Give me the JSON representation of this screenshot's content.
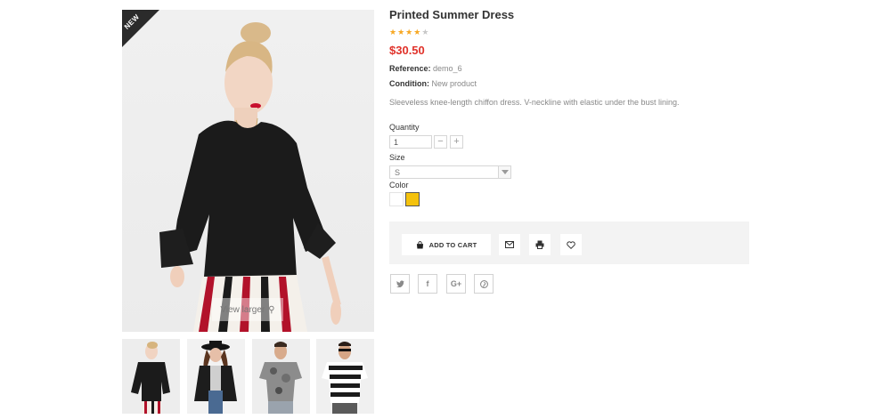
{
  "gallery": {
    "badge": "NEW",
    "view_larger": "View larger",
    "thumbnails": [
      {
        "icon": "thumb-black-top-woman"
      },
      {
        "icon": "thumb-hat-cardigan-woman"
      },
      {
        "icon": "thumb-printed-tee-man"
      },
      {
        "icon": "thumb-striped-tee-man"
      }
    ]
  },
  "product": {
    "name": "Printed Summer Dress",
    "rating": 4,
    "rating_max": 5,
    "price": "$30.50",
    "reference_label": "Reference:",
    "reference_value": "demo_6",
    "condition_label": "Condition:",
    "condition_value": "New product",
    "description": "Sleeveless knee-length chiffon dress. V-neckline with elastic under the bust lining."
  },
  "options": {
    "quantity_label": "Quantity",
    "quantity_value": "1",
    "size_label": "Size",
    "size_value": "S",
    "color_label": "Color",
    "colors": [
      "#ffffff",
      "#f4c20d"
    ],
    "selected_color": "#f4c20d"
  },
  "actions": {
    "add_to_cart": "ADD TO CART",
    "icons": [
      "email-icon",
      "print-icon",
      "heart-icon"
    ]
  },
  "share": [
    "twitter-icon",
    "facebook-icon",
    "google-plus-icon",
    "pinterest-icon"
  ],
  "colors": {
    "price": "#e0322a",
    "star": "#f7a823",
    "badge": "#2b2b2b"
  }
}
